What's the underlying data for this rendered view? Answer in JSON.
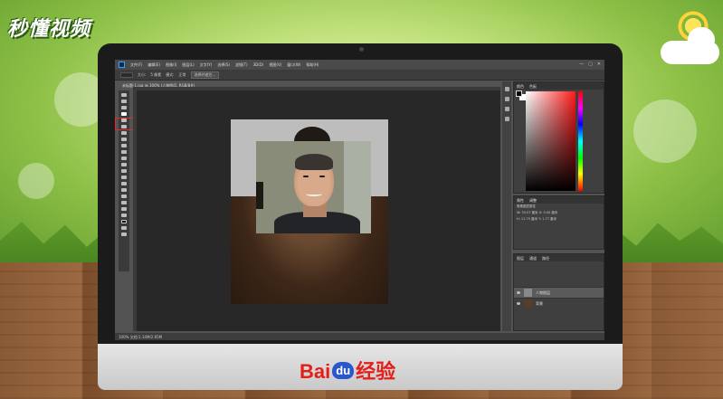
{
  "watermark": {
    "brand": "秒懂视频"
  },
  "monitor_brand": {
    "bai": "Bai",
    "du": "du",
    "jingyan": "经验"
  },
  "photoshop": {
    "menu": [
      "文件(F)",
      "编辑(E)",
      "图像(I)",
      "图层(L)",
      "文字(Y)",
      "选择(S)",
      "滤镜(T)",
      "3D(D)",
      "视图(V)",
      "窗口(W)",
      "帮助(H)"
    ],
    "options": {
      "size_label": "大小:",
      "size_value": "5 像素",
      "mode_label": "模式:",
      "mode_value": "正常",
      "select_subject_button": "选择并遮住..."
    },
    "document_tab": "未标题-1.jpg @ 100% (人物图层, RGB/8#)",
    "window_controls": [
      "—",
      "▢",
      "✕"
    ],
    "status": "100%    文档:1.14M/2.65M",
    "panels": {
      "color_tabs": [
        "颜色",
        "色板"
      ],
      "properties_tabs": [
        "属性",
        "调整"
      ],
      "properties_rows": [
        "像素图层属性",
        "W: 33.07 厘米   X: 0.00 厘米",
        "H: 11.75 厘米   Y: 1.77 厘米"
      ],
      "layers_tabs": [
        "图层",
        "通道",
        "路径"
      ],
      "layers": [
        {
          "name": "人物图层",
          "active": true
        },
        {
          "name": "背景",
          "active": false
        }
      ]
    }
  },
  "colors": {
    "highlight": "#e52a2a",
    "baidu_red": "#e41f19",
    "baidu_blue": "#2a57c9"
  }
}
